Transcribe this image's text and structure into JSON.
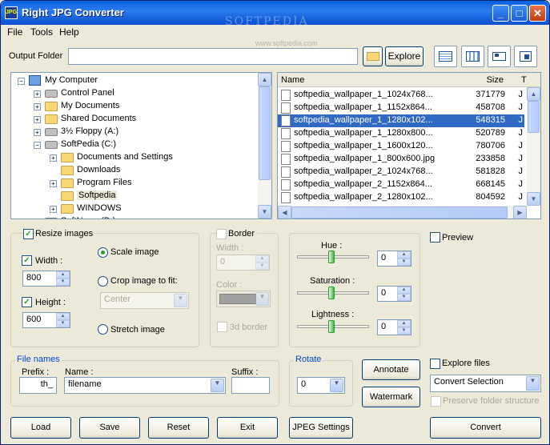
{
  "window": {
    "title": "Right JPG Converter",
    "app_icon": "JPG",
    "watermark": "SOFTPEDIA",
    "watermark_url": "www.softpedia.com"
  },
  "menu": [
    "File",
    "Tools",
    "Help"
  ],
  "output": {
    "label": "Output Folder",
    "value": "",
    "explore_label": "Explore"
  },
  "tree": [
    {
      "label": "My Computer",
      "icon": "computer-icon",
      "expander": "−"
    },
    {
      "label": "Control Panel",
      "icon": "control-panel-icon",
      "expander": "+"
    },
    {
      "label": "My Documents",
      "icon": "folder-icon",
      "expander": "+"
    },
    {
      "label": "Shared Documents",
      "icon": "folder-icon",
      "expander": "+"
    },
    {
      "label": "3½ Floppy (A:)",
      "icon": "floppy-icon",
      "expander": "+"
    },
    {
      "label": "SoftPedia (C:)",
      "icon": "drive-icon",
      "expander": "−"
    },
    {
      "label": "Documents and Settings",
      "icon": "folder-icon",
      "expander": "+"
    },
    {
      "label": "Downloads",
      "icon": "folder-icon",
      "expander": ""
    },
    {
      "label": "Program Files",
      "icon": "folder-icon",
      "expander": "+"
    },
    {
      "label": "Softpedia",
      "icon": "folder-icon",
      "expander": ""
    },
    {
      "label": "WINDOWS",
      "icon": "folder-icon",
      "expander": "+"
    },
    {
      "label": "SoftNews (D:)",
      "icon": "drive-icon",
      "expander": "+"
    }
  ],
  "files": {
    "headers": {
      "name": "Name",
      "size": "Size",
      "extra": "T"
    },
    "rows": [
      {
        "name": "softpedia_wallpaper_1_1024x768...",
        "size": "371779",
        "extra": "J"
      },
      {
        "name": "softpedia_wallpaper_1_1152x864...",
        "size": "458708",
        "extra": "J"
      },
      {
        "name": "softpedia_wallpaper_1_1280x102...",
        "size": "548315",
        "extra": "J"
      },
      {
        "name": "softpedia_wallpaper_1_1280x800...",
        "size": "520789",
        "extra": "J"
      },
      {
        "name": "softpedia_wallpaper_1_1600x120...",
        "size": "780706",
        "extra": "J"
      },
      {
        "name": "softpedia_wallpaper_1_800x600.jpg",
        "size": "233858",
        "extra": "J"
      },
      {
        "name": "softpedia_wallpaper_2_1024x768...",
        "size": "581828",
        "extra": "J"
      },
      {
        "name": "softpedia_wallpaper_2_1152x864...",
        "size": "668145",
        "extra": "J"
      },
      {
        "name": "softpedia_wallpaper_2_1280x102...",
        "size": "804592",
        "extra": "J"
      }
    ]
  },
  "resize": {
    "label": "Resize images",
    "checked": true,
    "width_label": "Width :",
    "width_value": "800",
    "height_label": "Height :",
    "height_value": "600",
    "scale_label": "Scale image",
    "crop_label": "Crop image to fit:",
    "crop_value": "Center",
    "stretch_label": "Stretch image"
  },
  "border": {
    "label": "Border",
    "width_label": "Width :",
    "width_value": "0",
    "color_label": "Color :",
    "three_d_label": "3d border"
  },
  "adjust": {
    "hue_label": "Hue :",
    "hue_value": "0",
    "hue_level": 0.5,
    "saturation_label": "Saturation :",
    "saturation_value": "0",
    "saturation_level": 0.5,
    "lightness_label": "Lightness :",
    "lightness_value": "0",
    "lightness_level": 0.5
  },
  "preview_label": "Preview",
  "filenames": {
    "group_label": "File names",
    "prefix_label": "Prefix :",
    "prefix_value": "th_",
    "name_label": "Name :",
    "name_value": "filename",
    "suffix_label": "Suffix :",
    "suffix_value": ""
  },
  "rotate": {
    "group_label": "Rotate",
    "value": "0"
  },
  "annotate_label": "Annotate",
  "watermark_label": "Watermark",
  "explore_files": {
    "label": "Explore files",
    "select_value": "Convert Selection",
    "preserve_label": "Preserve folder structure"
  },
  "buttons": {
    "load": "Load",
    "save": "Save",
    "reset": "Reset",
    "exit": "Exit",
    "jpeg": "JPEG Settings",
    "convert": "Convert"
  },
  "colors": {
    "title_bar": "#0a5fe0",
    "window_bg": "#ece9d8",
    "selection": "#316ac5",
    "check": "#21a121"
  }
}
